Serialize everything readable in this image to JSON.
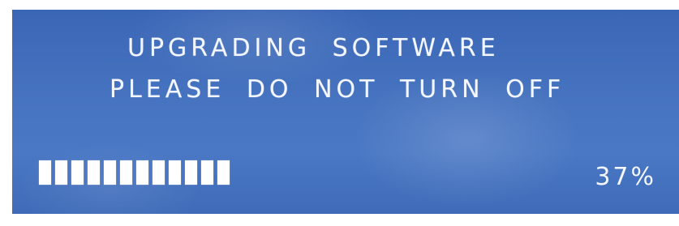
{
  "screen": {
    "title": "UPGRADING SOFTWARE",
    "warning": "PLEASE DO NOT TURN OFF",
    "progress_percent": 37,
    "progress_text": "37%",
    "progress_segments_filled": 12,
    "colors": {
      "background": "#4774c0",
      "text": "#f4f7ff",
      "bar": "#ffffff"
    }
  }
}
